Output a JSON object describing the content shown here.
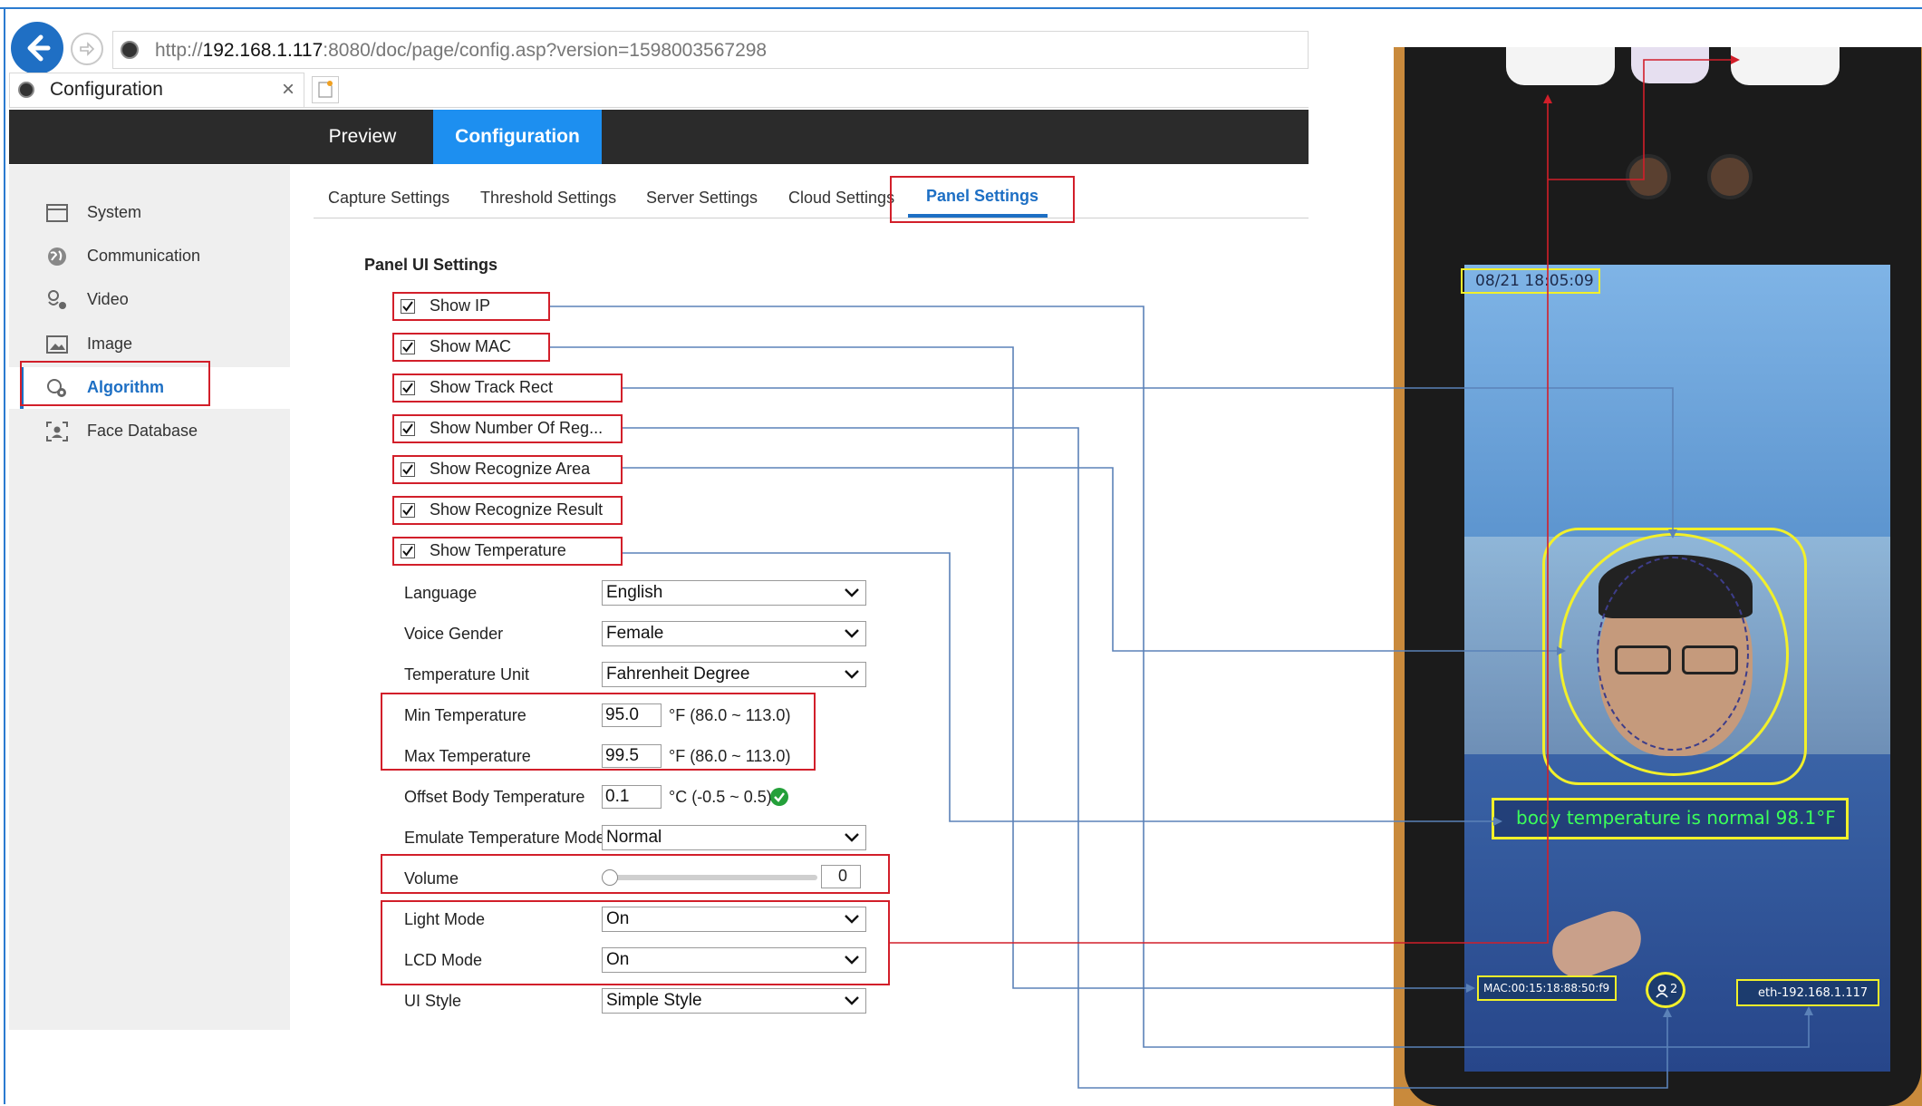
{
  "browser": {
    "url_prefix": "http://",
    "url_host": "192.168.1.117",
    "url_rest": ":8080/doc/page/config.asp?version=1598003567298",
    "tab_title": "Configuration",
    "tab_close": "×"
  },
  "header": {
    "preview": "Preview",
    "configuration": "Configuration"
  },
  "sidebar": {
    "items": [
      {
        "label": "System",
        "icon": "monitor-icon"
      },
      {
        "label": "Communication",
        "icon": "globe-icon"
      },
      {
        "label": "Video",
        "icon": "camera-icon"
      },
      {
        "label": "Image",
        "icon": "image-icon"
      },
      {
        "label": "Algorithm",
        "icon": "algorithm-icon"
      },
      {
        "label": "Face Database",
        "icon": "face-icon"
      }
    ]
  },
  "subtabs": [
    "Capture Settings",
    "Threshold Settings",
    "Server Settings",
    "Cloud Settings",
    "Panel Settings"
  ],
  "section_title": "Panel UI Settings",
  "checkboxes": [
    {
      "label": "Show IP",
      "checked": true
    },
    {
      "label": "Show MAC",
      "checked": true
    },
    {
      "label": "Show Track Rect",
      "checked": true
    },
    {
      "label": "Show Number Of Reg...",
      "checked": true
    },
    {
      "label": "Show Recognize Area",
      "checked": true
    },
    {
      "label": "Show Recognize Result",
      "checked": true
    },
    {
      "label": "Show Temperature",
      "checked": true
    }
  ],
  "form": {
    "language": {
      "label": "Language",
      "value": "English"
    },
    "voice_gender": {
      "label": "Voice Gender",
      "value": "Female"
    },
    "temperature_unit": {
      "label": "Temperature Unit",
      "value": "Fahrenheit Degree"
    },
    "min_temperature": {
      "label": "Min Temperature",
      "value": "95.0",
      "range": "°F (86.0 ~ 113.0)"
    },
    "max_temperature": {
      "label": "Max Temperature",
      "value": "99.5",
      "range": "°F (86.0 ~ 113.0)"
    },
    "offset_body_temperature": {
      "label": "Offset Body Temperature",
      "value": "0.1",
      "range": "°C (-0.5 ~ 0.5)"
    },
    "emulate_temperature_mode": {
      "label": "Emulate Temperature Mode",
      "value": "Normal"
    },
    "volume": {
      "label": "Volume",
      "value": "0",
      "level": 0
    },
    "light_mode": {
      "label": "Light Mode",
      "value": "On"
    },
    "lcd_mode": {
      "label": "LCD Mode",
      "value": "On"
    },
    "ui_style": {
      "label": "UI Style",
      "value": "Simple Style"
    }
  },
  "device_screen": {
    "datetime": "08/21 18:05:09",
    "temperature_message": "body temperature is normal 98.1°F",
    "mac": "MAC:00:15:18:88:50:f9",
    "registered_count": "2",
    "ip": "eth-192.168.1.117"
  },
  "colors": {
    "accent_blue": "#1d8ff0",
    "header_dark": "#2b2b2b",
    "highlight_red": "#d21f2a",
    "annotation_line": "#5b82b8",
    "overlay_yellow": "#f2f02a",
    "status_green": "#24a03a"
  }
}
